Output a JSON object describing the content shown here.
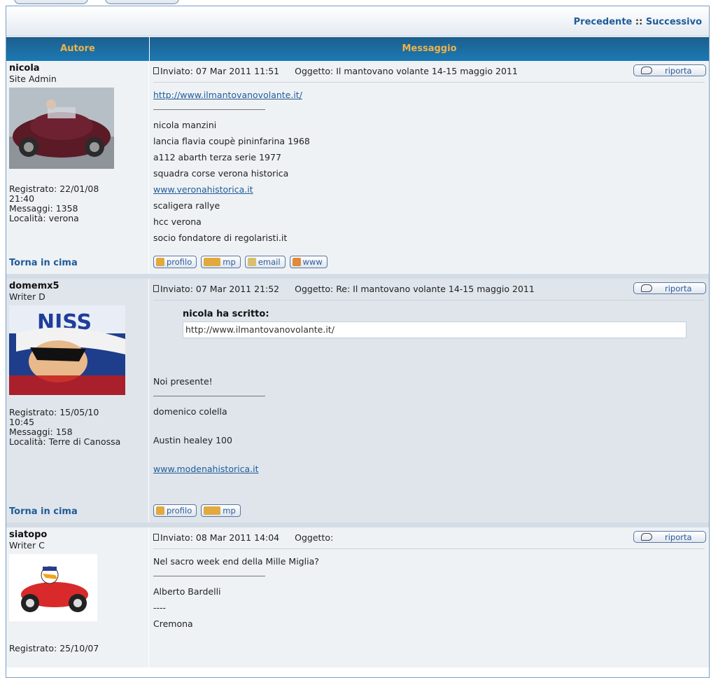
{
  "nav": {
    "prev": "Precedente",
    "sep": "::",
    "next": "Successivo"
  },
  "table_header": {
    "author": "Autore",
    "message": "Messaggio"
  },
  "labels": {
    "sent_prefix": "Inviato:",
    "subject_prefix": "Oggetto:",
    "report": "riporta",
    "back_to_top": "Torna in cima",
    "profile": "profilo",
    "pm": "mp",
    "email": "email",
    "www": "www",
    "registered": "Registrato:",
    "messages": "Messaggi:",
    "location": "Località:"
  },
  "posts": [
    {
      "author": "nicola",
      "rank": "Site Admin",
      "registered_date": "22/01/08",
      "registered_time": "21:40",
      "messages": "1358",
      "location": "verona",
      "date": "07 Mar 2011 11:51",
      "subject": "Il mantovano volante 14-15 maggio 2011",
      "link": "http://www.ilmantovanovolante.it/",
      "signature": [
        "nicola manzini",
        "lancia flavia coupè pininfarina 1968",
        "a112 abarth terza serie 1977",
        "squadra corse verona historica"
      ],
      "sig_link": "www.veronahistorica.it",
      "signature2": [
        "scaligera rallye",
        "hcc verona",
        "socio fondatore di regolaristi.it"
      ]
    },
    {
      "author": "domemx5",
      "rank": "Writer D",
      "registered_date": "15/05/10",
      "registered_time": "10:45",
      "messages": "158",
      "location": "Terre di Canossa",
      "date": "07 Mar 2011 21:52",
      "subject": "Re: Il mantovano volante 14-15 maggio 2011",
      "quote_author": "nicola ha scritto:",
      "quote_text": "http://www.ilmantovanovolante.it/",
      "body": "Noi presente!",
      "signature": [
        "domenico colella",
        "Austin healey 100"
      ],
      "sig_link": "www.modenahistorica.it",
      "avatar_text": "NISS"
    },
    {
      "author": "siatopo",
      "rank": "Writer C",
      "registered_date": "25/10/07",
      "date": "08 Mar 2011 14:04",
      "subject": "",
      "body": "Nel sacro week end della Mille Miglia?",
      "signature": [
        "Alberto Bardelli",
        "----",
        "Cremona"
      ]
    }
  ],
  "colors": {
    "header_blue": "#1c6fa6",
    "header_text": "#f0b34a",
    "link_blue": "#1f5c99",
    "row_light": "#eff2f5",
    "row_dark": "#dfe5eb"
  }
}
